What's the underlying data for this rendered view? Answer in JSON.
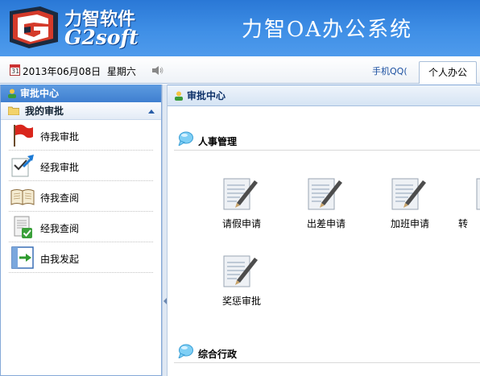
{
  "header": {
    "logo_cn": "力智软件",
    "logo_en": "G2soft",
    "system_title": "力智OA办公系统"
  },
  "topbar": {
    "date": "2013年06月08日",
    "weekday": "星期六",
    "qq_link": "手机QQ(",
    "tab_personal": "个人办公"
  },
  "left": {
    "panel_title": "审批中心",
    "group_title": "我的审批",
    "items": [
      {
        "label": "待我审批",
        "icon": "red-flag-icon"
      },
      {
        "label": "经我审批",
        "icon": "approved-arrow-icon"
      },
      {
        "label": "待我查阅",
        "icon": "open-book-icon"
      },
      {
        "label": "经我查阅",
        "icon": "checked-document-icon"
      },
      {
        "label": "由我发起",
        "icon": "initiate-arrow-icon"
      }
    ]
  },
  "right": {
    "panel_title": "审批中心",
    "sections": [
      {
        "title": "人事管理",
        "apps": [
          {
            "label": "请假申请"
          },
          {
            "label": "出差申请"
          },
          {
            "label": "加班申请"
          },
          {
            "label": "转"
          },
          {
            "label": "奖惩审批"
          }
        ]
      },
      {
        "title": "综合行政",
        "apps": []
      }
    ]
  },
  "colors": {
    "header_blue": "#3f8fe6",
    "panel_blue": "#3f7fd0",
    "link_blue": "#1a4fa0"
  }
}
